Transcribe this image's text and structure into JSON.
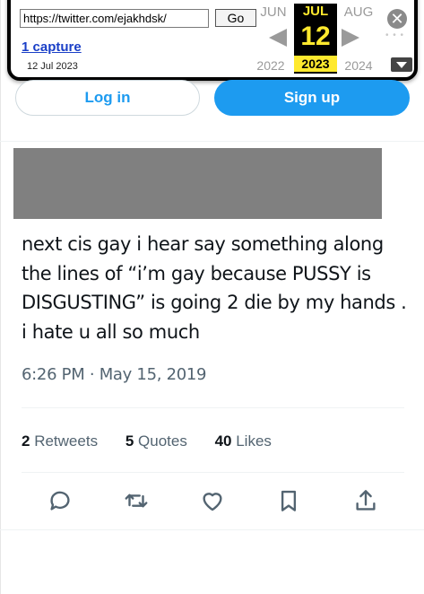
{
  "wayback": {
    "url_value": "https://twitter.com/ejakhdsk/",
    "go_label": "Go",
    "captures_label": "1 capture",
    "capture_date": "12 Jul 2023",
    "prev_month": "JUN",
    "current_month": "JUL",
    "next_month": "AUG",
    "current_day": "12",
    "prev_year": "2022",
    "current_year": "2023",
    "next_year": "2024",
    "close_glyph": "✕",
    "accent_color": "#ffe92e"
  },
  "auth": {
    "login_label": "Log in",
    "signup_label": "Sign up",
    "brand_color": "#1d9bf0"
  },
  "tweet": {
    "text_lines": [
      "next cis gay i hear say something along",
      "the lines of “i’m gay because PUSSY is",
      "DISGUSTING” is going 2 die by my hands .",
      "i hate u all so much"
    ],
    "timestamp": "6:26 PM · May 15, 2019",
    "stats": {
      "retweets_count": "2",
      "retweets_label": "Retweets",
      "quotes_count": "5",
      "quotes_label": "Quotes",
      "likes_count": "40",
      "likes_label": "Likes"
    }
  },
  "actions": [
    "reply-icon",
    "retweet-icon",
    "like-icon",
    "bookmark-icon",
    "share-icon"
  ]
}
